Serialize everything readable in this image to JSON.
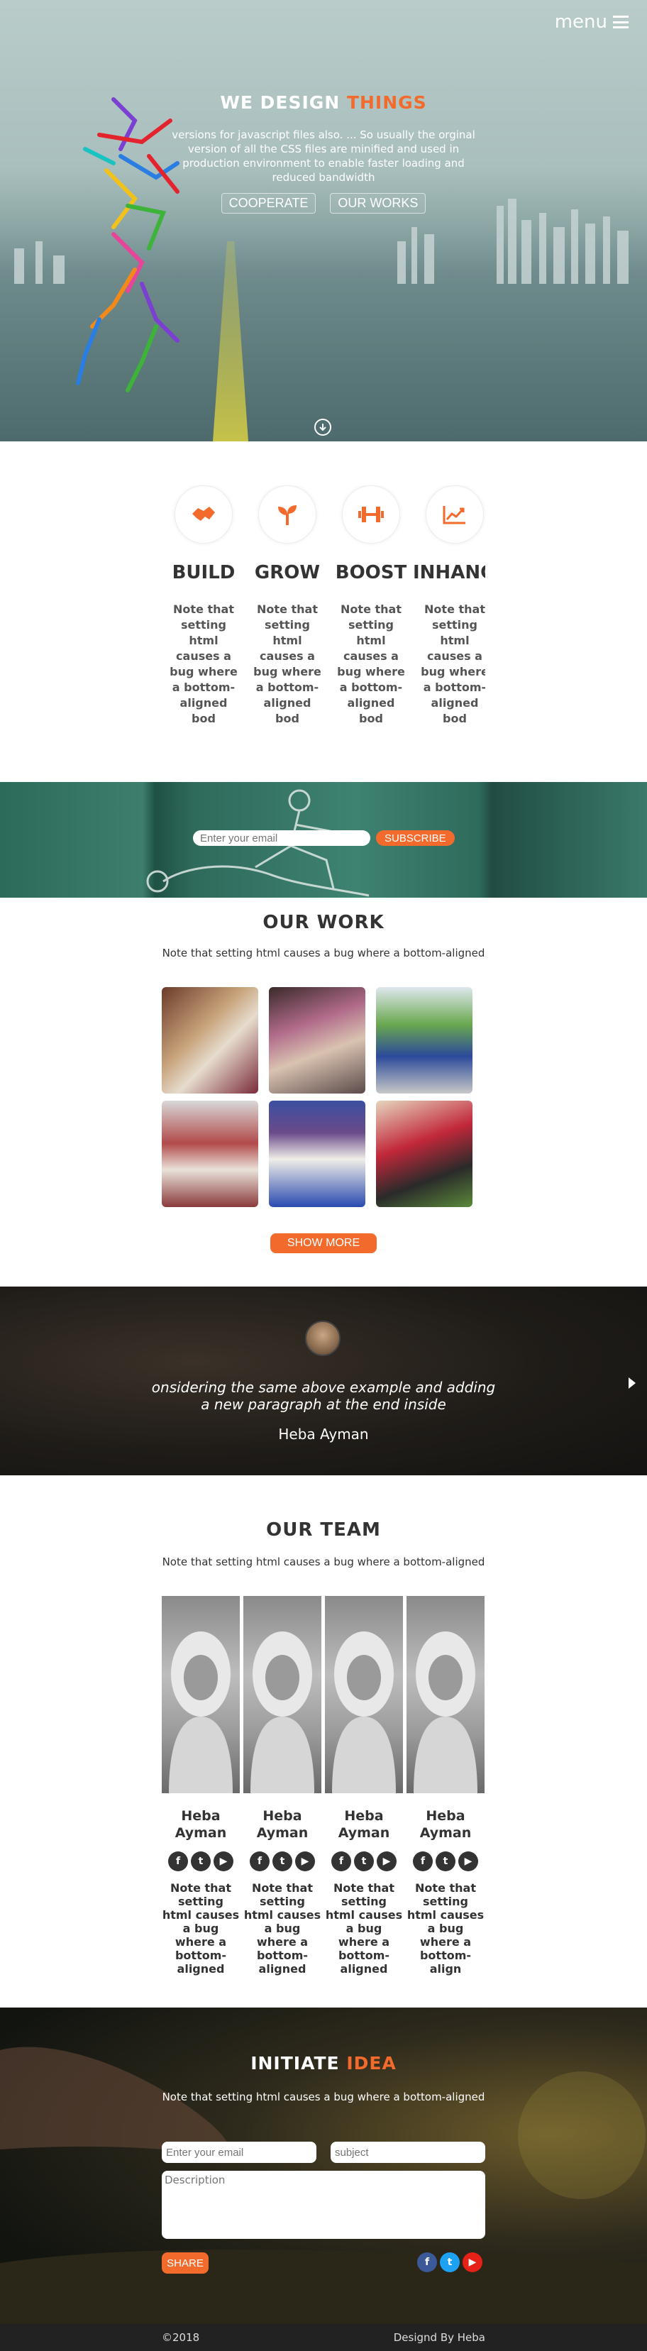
{
  "header": {
    "menu_label": "menu"
  },
  "hero": {
    "title_main": "WE DESIGN ",
    "title_accent": "THINGS",
    "subtitle": "versions for javascript files also. ... So usually the orginal version of all the CSS files are minified and used in production environment to enable faster loading and reduced bandwidth",
    "buttons": [
      "COOPERATE",
      "OUR WORKS"
    ]
  },
  "services": [
    {
      "icon": "handshake-icon",
      "title": "BUILD",
      "text": "Note that setting html causes a bug where a bottom-aligned bod"
    },
    {
      "icon": "sprout-icon",
      "title": "GROW",
      "text": "Note that setting html causes a bug where a bottom-aligned bod"
    },
    {
      "icon": "dumbbell-icon",
      "title": "BOOST",
      "text": "Note that setting html causes a bug where a bottom-aligned bod"
    },
    {
      "icon": "chart-line-icon",
      "title": "INHANCE",
      "text": "Note that setting html causes a bug where a bottom-aligned bod"
    }
  ],
  "subscribe": {
    "placeholder": "Enter your email",
    "button": "SUBSCRIBE"
  },
  "work": {
    "title": "OUR WORK",
    "subtitle": "Note that setting html causes a bug where a bottom-aligned",
    "button": "SHOW MORE"
  },
  "testimonial": {
    "quote": "onsidering the same above example and adding a new paragraph at the end inside",
    "name": "Heba Ayman"
  },
  "team": {
    "title": "OUR TEAM",
    "subtitle": "Note that setting html causes a bug where a bottom-aligned",
    "members": [
      {
        "name": "Heba Ayman",
        "text": "Note that setting html causes a bug where a bottom-aligned"
      },
      {
        "name": "Heba Ayman",
        "text": "Note that setting html causes a bug where a bottom-aligned"
      },
      {
        "name": "Heba Ayman",
        "text": "Note that setting html causes a bug where a bottom-aligned"
      },
      {
        "name": "Heba Ayman",
        "text": "Note that setting html causes a bug where a bottom-align"
      }
    ]
  },
  "contact": {
    "title_main": "INITIATE ",
    "title_accent": "IDEA",
    "subtitle": "Note that setting html causes a bug where a bottom-aligned",
    "email_placeholder": "Enter your email",
    "subject_placeholder": "subject",
    "description_placeholder": "Description",
    "button": "SHARE"
  },
  "footer": {
    "copyright": "©2018",
    "credit": "Designd By Heba"
  },
  "colors": {
    "accent": "#f26b2d",
    "facebook": "#3b5998",
    "twitter": "#1da1f2",
    "youtube": "#e62117"
  }
}
